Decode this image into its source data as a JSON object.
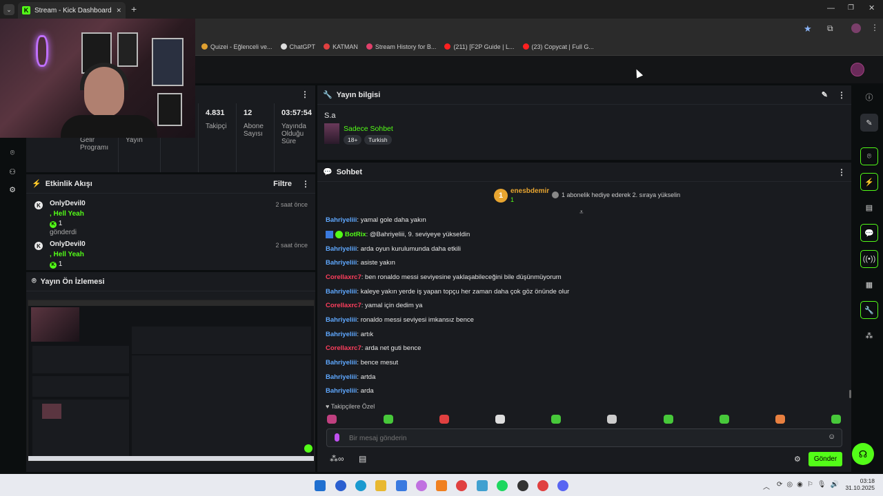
{
  "browser": {
    "tab_title": "Stream - Kick Dashboard",
    "tab_close": "✕",
    "new_tab": "+",
    "bookmarks": [
      {
        "label": "Quizei - Eğlenceli ve...",
        "color": "#e0a030"
      },
      {
        "label": "ChatGPT",
        "color": "#dddddd"
      },
      {
        "label": "KATMAN",
        "color": "#e04040"
      },
      {
        "label": "Stream History for B...",
        "color": "#e0406a"
      },
      {
        "label": "(211) [F2P Guide | L...",
        "color": "#ff2020"
      },
      {
        "label": "(23) Copycat | Full G...",
        "color": "#ff2020"
      }
    ]
  },
  "stats": [
    {
      "value": "",
      "label": "Gelir Programı"
    },
    {
      "value": "",
      "label": "Yayın"
    },
    {
      "value": "",
      "label": ""
    },
    {
      "value": "4.831",
      "label": "Takipçi"
    },
    {
      "value": "12",
      "label": "Abone Sayısı"
    },
    {
      "value": "03:57:54",
      "label": "Yayında Olduğu Süre"
    }
  ],
  "activity": {
    "title": "Etkinlik Akışı",
    "filter_label": "Filtre",
    "items": [
      {
        "user": "OnlyDevil0",
        "message": ", Hell Yeah",
        "count": "1",
        "extra": "gönderdi",
        "time": "2 saat önce"
      },
      {
        "user": "OnlyDevil0",
        "message": ", Hell Yeah",
        "count": "1",
        "extra": "",
        "time": "2 saat önce"
      }
    ]
  },
  "preview": {
    "title": "Yayın Ön İzlemesi"
  },
  "stream_info": {
    "title": "Yayın bilgisi",
    "stream_title": "S.a",
    "category": "Sadece Sohbet",
    "tags": [
      "18+",
      "Turkish"
    ]
  },
  "chat": {
    "title": "Sohbet",
    "gift_user": "enesbdemir",
    "gift_rank": "1",
    "gift_count": "1",
    "gift_prompt": "1 abonelik hediye ederek 2. sıraya yükselin",
    "messages": [
      {
        "user": "Bahriyeliii",
        "color": "blue",
        "text": ": yamal gole daha yakın"
      },
      {
        "user": "BotRix",
        "color": "green",
        "text": ": @Bahriyeliii, 9. seviyeye yükseldin"
      },
      {
        "user": "Bahriyeliii",
        "color": "blue",
        "text": ": arda oyun kurulumunda daha etkili"
      },
      {
        "user": "Bahriyeliii",
        "color": "blue",
        "text": ": asiste yakın"
      },
      {
        "user": "Corellaxrc7",
        "color": "red",
        "text": ": ben ronaldo messi seviyesine yaklaşabileceğini bile düşünmüyorum"
      },
      {
        "user": "Bahriyeliii",
        "color": "blue",
        "text": ": kaleye yakın yerde iş yapan topçu her zaman daha çok göz önünde olur"
      },
      {
        "user": "Corellaxrc7",
        "color": "red",
        "text": ": yamal için dedim ya"
      },
      {
        "user": "Bahriyeliii",
        "color": "blue",
        "text": ": ronaldo messi seviyesi imkansız bence"
      },
      {
        "user": "Bahriyeliii",
        "color": "blue",
        "text": ": artık"
      },
      {
        "user": "Corellaxrc7",
        "color": "red",
        "text": ": arda net guti bence"
      },
      {
        "user": "Bahriyeliii",
        "color": "blue",
        "text": ": bence mesut"
      },
      {
        "user": "Bahriyeliii",
        "color": "blue",
        "text": ": artda"
      },
      {
        "user": "Bahriyeliii",
        "color": "blue",
        "text": ": arda"
      }
    ],
    "follower_only": "Takipçilere Özel",
    "input_placeholder": "Bir mesaj gönderin",
    "send_label": "Gönder"
  },
  "taskbar": {
    "time": "03:18",
    "date": "31.10.2025"
  },
  "colors": {
    "accent": "#53fc18",
    "panel": "#191b1f",
    "bg": "#0b0e0f"
  }
}
